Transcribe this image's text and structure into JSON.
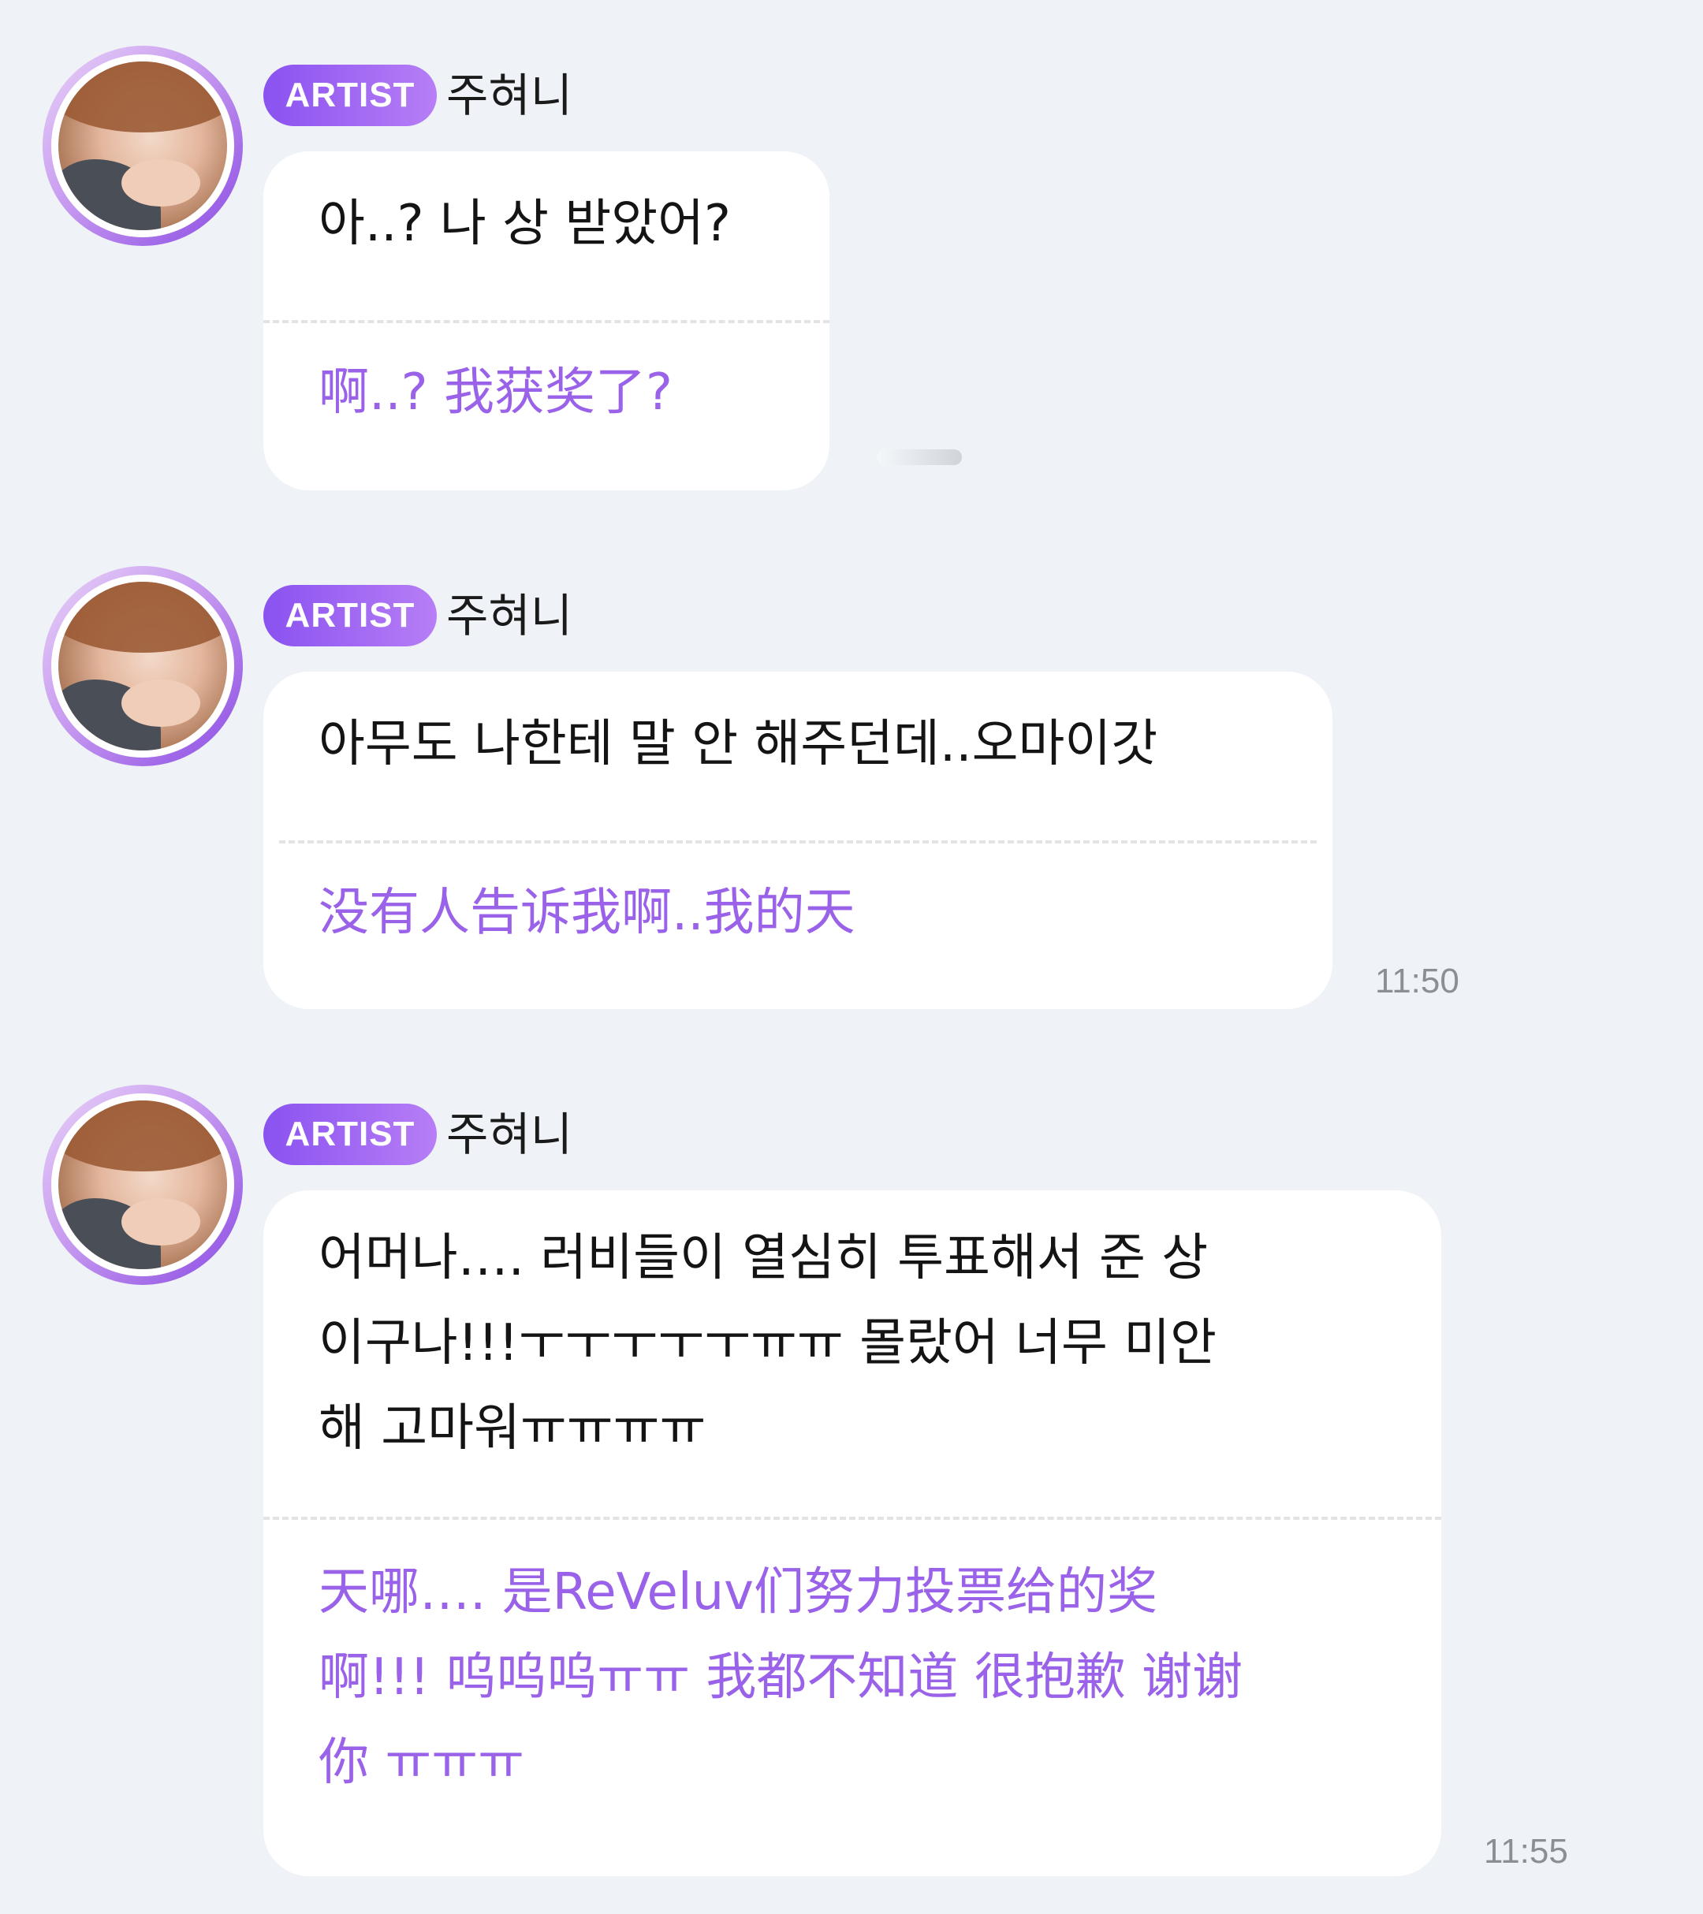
{
  "messages": [
    {
      "badge": "ARTIST",
      "name": "주혀니",
      "korean_lines": [
        "아..? 나 상 받았어?"
      ],
      "chinese_lines": [
        "啊..? 我获奖了?"
      ],
      "time": ""
    },
    {
      "badge": "ARTIST",
      "name": "주혀니",
      "korean_lines": [
        "아무도 나한테 말 안 해주던데..오마이갓"
      ],
      "chinese_lines": [
        "没有人告诉我啊..我的天"
      ],
      "time": "11:50"
    },
    {
      "badge": "ARTIST",
      "name": "주혀니",
      "korean_lines": [
        "어머나…. 러비들이 열심히 투표해서 준 상",
        "이구나!!!ㅜㅜㅜㅜㅜㅠㅠ 몰랐어 너무 미안",
        "해 고마워ㅠㅠㅠㅠ"
      ],
      "chinese_lines": [
        "天哪…. 是ReVeluv们努力投票给的奖",
        "啊!!! 呜呜呜ㅠㅠ 我都不知道 很抱歉 谢谢",
        "你 ㅠㅠㅠ"
      ],
      "time": "11:55"
    }
  ]
}
